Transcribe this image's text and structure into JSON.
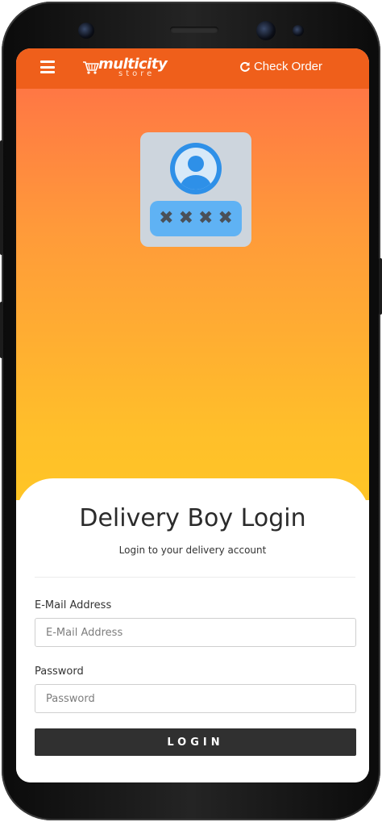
{
  "header": {
    "brand_main": "multicity",
    "brand_sub": "store",
    "check_order_label": "Check Order"
  },
  "illustration": {
    "pin_mask": [
      "✖",
      "✖",
      "✖",
      "✖"
    ]
  },
  "login": {
    "title": "Delivery Boy Login",
    "subtitle": "Login to your delivery account",
    "email_label": "E-Mail Address",
    "email_placeholder": "E-Mail Address",
    "email_value": "",
    "password_label": "Password",
    "password_placeholder": "Password",
    "password_value": "",
    "button_label": "LOGIN"
  },
  "icons": {
    "menu": "hamburger-menu-icon",
    "refresh": "refresh-icon",
    "cart": "shopping-cart-icon",
    "user": "user-avatar-icon"
  },
  "colors": {
    "topbar": "#ef5f1b",
    "gradient_top": "#ff6d47",
    "gradient_bottom": "#ffc526",
    "button": "#303030",
    "pin_box": "#5fb2f4",
    "avatar_blue": "#2e90e8"
  }
}
